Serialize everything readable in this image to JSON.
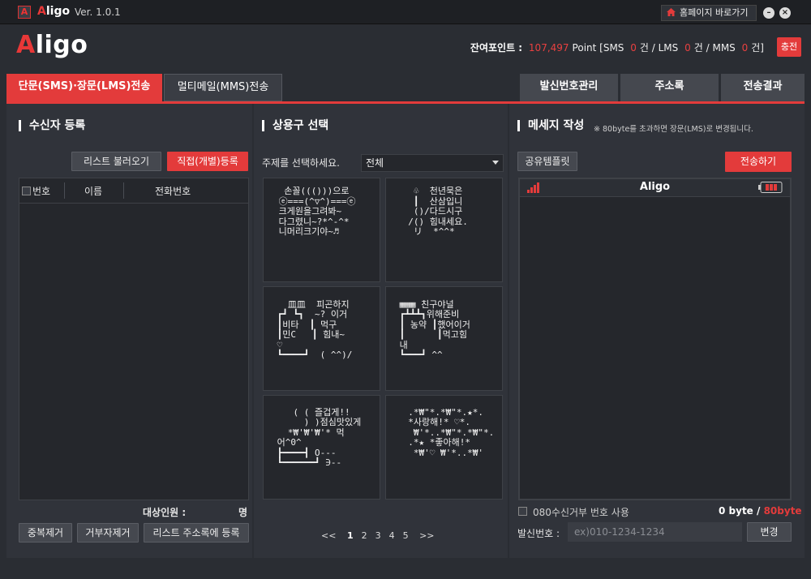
{
  "titlebar": {
    "app_name_red": "A",
    "app_name_rest": "ligo",
    "version": "Ver. 1.0.1",
    "home_button": "홈페이지 바로가기",
    "minimize": "–",
    "close": "×"
  },
  "header": {
    "logo_red": "A",
    "logo_rest": "ligo",
    "points_label": "잔여포인트 :",
    "points_value": "107,497",
    "points_unit": "Point [SMS",
    "sms_count": "0",
    "sms_unit": "건 / LMS",
    "lms_count": "0",
    "lms_unit": "건 / MMS",
    "mms_count": "0",
    "mms_unit": "건]",
    "charge_button": "충전"
  },
  "tabs": {
    "sms_lms": "단문(SMS)·장문(LMS)전송",
    "mms": "멀티메일(MMS)전송",
    "sender_mgmt": "발신번호관리",
    "address_book": "주소록",
    "results": "전송결과"
  },
  "recipients": {
    "title": "수신자 등록",
    "load_list": "리스트 불러오기",
    "direct_register": "직접(개별)등록",
    "col_no": "번호",
    "col_name": "이름",
    "col_phone": "전화번호",
    "target_label": "대상인원 :",
    "target_unit": "명",
    "dedupe": "중복제거",
    "remove_rejected": "거부자제거",
    "save_to_address": "리스트 주소록에 등록"
  },
  "phrases": {
    "title": "상용구 선택",
    "topic_label": "주제를 선택하세요.",
    "topic_value": "전체",
    "cards": [
      "  손꼴((()))으로\n ⓔ===(^▽^)===ⓔ\n 크게원을그려봐~\n 다그렸니~?*^-^*\n 니머리크기야~♬",
      "   ♧  천년묵은\n   ┃  산삼입니\n   ()/다드시구\n  /() 힘내세요.\n   リ  *^^*",
      "\n   皿皿  피곤하지\n ┏┛ ┗┓  ~? 이거\n ┃비타  ┃ 먹구\n ┃민C   ┃ 힘내~\n ♡\n ┗━━━━┛  ( ^^)/",
      "\n ▦▦▦ 친구야널\n ┏┻┻┻┓위해준비\n ┃ 농약 ┃했어이거\n ┃      ┃먹고힘\n 내\n ┗━━━┛ ^^",
      "\n    ( ( 즐겁게!!\n      ) )점심맛있게\n   *₩'₩'₩'* 먹\n 어^0^\n ┣━━━━┫ O---\n ┗━━━━━━┛ ∋--",
      "\n  .*₩\"*.*₩\"*.★*.\n  *사랑해!* ♡*.\n   ₩'*..*₩\"*.*₩\"*.\n  .*★ *좋아해!*\n   *₩'♡ ₩'*..*₩'"
    ],
    "pager": {
      "prev": "<<",
      "pages": [
        "1",
        "2",
        "3",
        "4",
        "5"
      ],
      "next": ">>"
    }
  },
  "message": {
    "title": "메세지 작성",
    "hint": "※ 80byte를 초과하면 장문(LMS)로 변경됩니다.",
    "template_button": "공유템플릿",
    "send_button": "전송하기",
    "phone_title": "Aligo",
    "optout_label": "080수신거부 번호 사용",
    "byte_count": "0 byte",
    "byte_sep": " / ",
    "byte_limit": "80byte",
    "sender_label": "발신번호 :",
    "sender_placeholder": "ex)010-1234-1234",
    "change_button": "변경"
  },
  "colors": {
    "accent": "#e33b3b",
    "background": "#2a2d33",
    "panel": "#30333a"
  }
}
